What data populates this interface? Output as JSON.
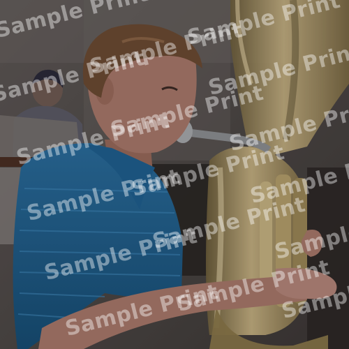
{
  "image": {
    "subject": "teen-playing-tuba",
    "palette": {
      "background": "#514b49",
      "shirt": "#1d5d8a",
      "skin": "#a8786a",
      "hair": "#6b4a33",
      "brass": "#a08c5a"
    }
  },
  "watermark": {
    "text": "Sample Print"
  }
}
